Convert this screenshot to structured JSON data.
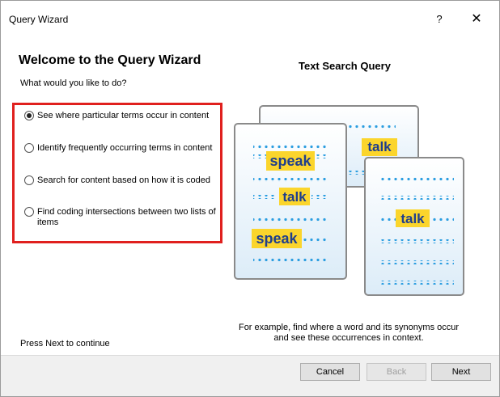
{
  "window": {
    "title": "Query Wizard",
    "help_label": "?",
    "close_label": "✕"
  },
  "main": {
    "heading": "Welcome to the Query Wizard",
    "subprompt": "What would you like to do?",
    "options": [
      {
        "label": "See where particular terms occur in content",
        "selected": true
      },
      {
        "label": "Identify frequently occurring terms in content",
        "selected": false
      },
      {
        "label": "Search for content based on how it is coded",
        "selected": false
      },
      {
        "label": "Find coding intersections between two lists of items",
        "selected": false
      }
    ],
    "press_next": "Press Next to continue"
  },
  "illustration": {
    "title": "Text Search Query",
    "words": {
      "speak": "speak",
      "talk": "talk"
    },
    "caption_line1": "For example, find where a word and its synonyms occur",
    "caption_line2": "and see these occurrences in context.",
    "colors": {
      "highlight": "#fbd52c",
      "word": "#1f3e8c",
      "dots": "#2a9de0",
      "card_border": "#8a8a8a",
      "card_fill": "#eaf4fb"
    }
  },
  "footer": {
    "cancel_label": "Cancel",
    "back_label": "Back",
    "next_label": "Next"
  }
}
